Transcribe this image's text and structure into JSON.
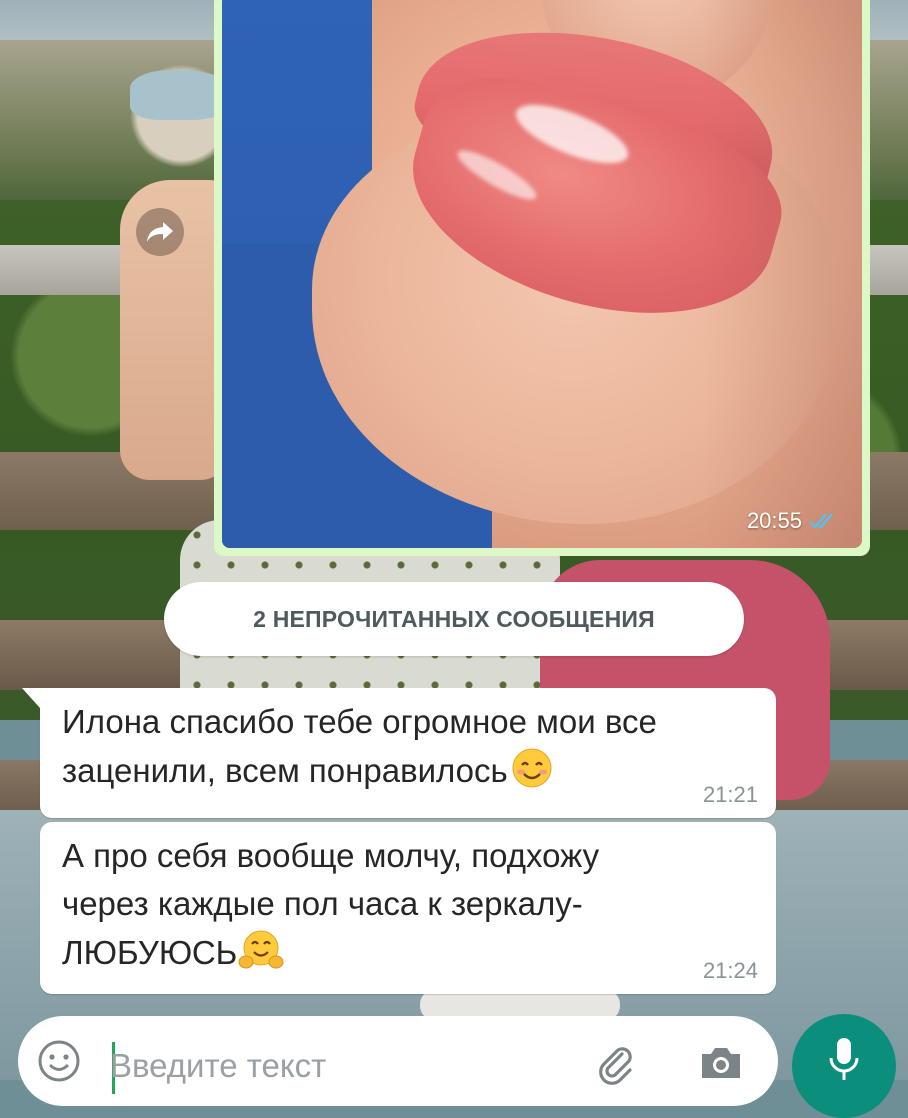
{
  "image_message": {
    "time": "20:55",
    "status_icon": "double-check-icon",
    "status_color": "#4fc3f7"
  },
  "unread_banner": {
    "label": "2 НЕПРОЧИТАННЫХ СООБЩЕНИЯ"
  },
  "messages": [
    {
      "text": "Илона спасибо тебе огромное мои все заценили, всем понравилось",
      "emoji": "smiling-face-icon",
      "time": "21:21"
    },
    {
      "text": "А про себя вообще молчу, подхожу через каждые пол часа к зеркалу- ЛЮБУЮСЬ",
      "emoji": "hugging-face-icon",
      "time": "21:24"
    }
  ],
  "composer": {
    "placeholder": "Введите текст",
    "value": ""
  },
  "colors": {
    "outgoing_bubble": "#dcf8c6",
    "incoming_bubble": "#ffffff",
    "mic_button": "#0b8f7c"
  }
}
